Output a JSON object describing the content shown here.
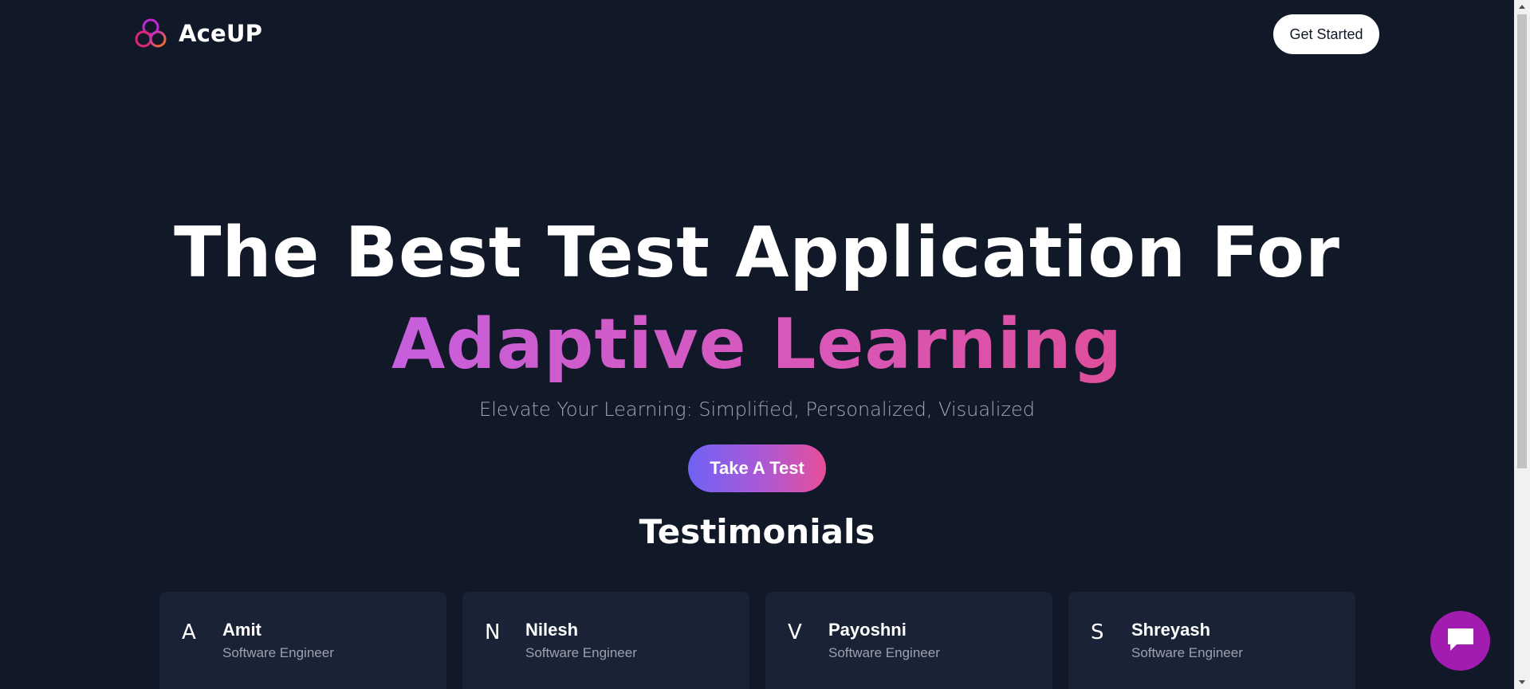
{
  "header": {
    "logo_text": "AceUP",
    "get_started_label": "Get Started"
  },
  "hero": {
    "line1": "The Best Test Application For",
    "line2": "Adaptive Learning",
    "subtitle": "Elevate Your Learning: Simplified, Personalized, Visualized",
    "cta_label": "Take A Test"
  },
  "testimonials": {
    "title": "Testimonials",
    "items": [
      {
        "initial": "A",
        "name": "Amit",
        "role": "Software Engineer"
      },
      {
        "initial": "N",
        "name": "Nilesh",
        "role": "Software Engineer"
      },
      {
        "initial": "V",
        "name": "Payoshni",
        "role": "Software Engineer"
      },
      {
        "initial": "S",
        "name": "Shreyash",
        "role": "Software Engineer"
      }
    ]
  },
  "colors": {
    "background": "#111827",
    "card": "#1a2236",
    "accent_gradient_start": "#7062f4",
    "accent_gradient_end": "#e84e9a",
    "chat_button": "#a21caf"
  },
  "icons": {
    "logo": "three-rings-logo-icon",
    "chat": "chat-bubble-icon"
  }
}
